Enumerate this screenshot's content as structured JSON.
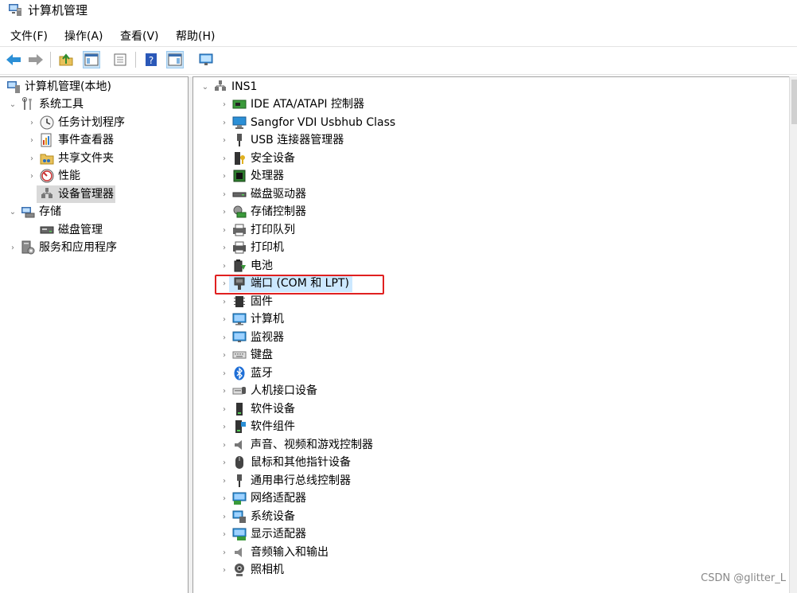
{
  "window": {
    "title": "计算机管理"
  },
  "menu": [
    {
      "label": "文件(F)"
    },
    {
      "label": "操作(A)"
    },
    {
      "label": "查看(V)"
    },
    {
      "label": "帮助(H)"
    }
  ],
  "left_tree": {
    "root": "计算机管理(本地)",
    "system_tools": "系统工具",
    "task_scheduler": "任务计划程序",
    "event_viewer": "事件查看器",
    "shared_folders": "共享文件夹",
    "performance": "性能",
    "device_manager": "设备管理器",
    "storage": "存储",
    "disk_management": "磁盘管理",
    "services_apps": "服务和应用程序"
  },
  "device_tree": {
    "root": "INS1",
    "items": [
      {
        "label": "IDE ATA/ATAPI 控制器"
      },
      {
        "label": "Sangfor VDI Usbhub Class"
      },
      {
        "label": "USB 连接器管理器"
      },
      {
        "label": "安全设备"
      },
      {
        "label": "处理器"
      },
      {
        "label": "磁盘驱动器"
      },
      {
        "label": "存储控制器"
      },
      {
        "label": "打印队列"
      },
      {
        "label": "打印机"
      },
      {
        "label": "电池"
      },
      {
        "label": "端口 (COM 和 LPT)"
      },
      {
        "label": "固件"
      },
      {
        "label": "计算机"
      },
      {
        "label": "监视器"
      },
      {
        "label": "键盘"
      },
      {
        "label": "蓝牙"
      },
      {
        "label": "人机接口设备"
      },
      {
        "label": "软件设备"
      },
      {
        "label": "软件组件"
      },
      {
        "label": "声音、视频和游戏控制器"
      },
      {
        "label": "鼠标和其他指针设备"
      },
      {
        "label": "通用串行总线控制器"
      },
      {
        "label": "网络适配器"
      },
      {
        "label": "系统设备"
      },
      {
        "label": "显示适配器"
      },
      {
        "label": "音频输入和输出"
      },
      {
        "label": "照相机"
      }
    ]
  },
  "watermark": "CSDN @glitter_L",
  "colors": {
    "selection": "#d9d9d9",
    "highlight": "#cce8ff",
    "annotation": "#e02020"
  }
}
